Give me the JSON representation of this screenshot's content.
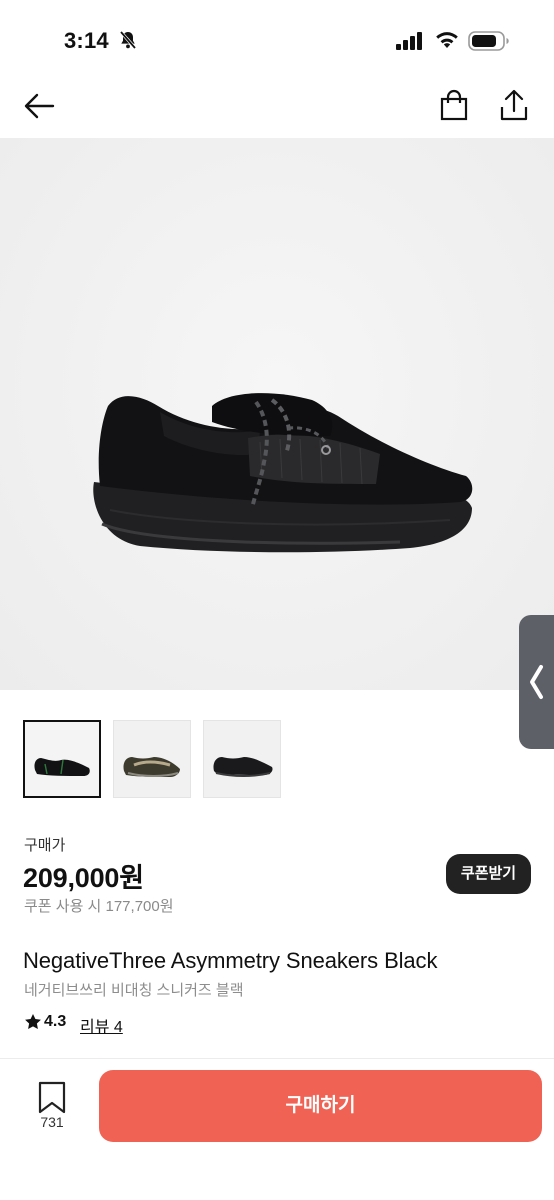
{
  "status_bar": {
    "time": "3:14"
  },
  "header": {
    "back_icon": "arrow-left-icon",
    "bag_icon": "shopping-bag-icon",
    "share_icon": "share-upload-icon"
  },
  "gallery": {
    "thumbnails": [
      {
        "alt": "black sneaker side view",
        "selected": true
      },
      {
        "alt": "olive sneaker top view",
        "selected": false
      },
      {
        "alt": "black sneaker side view dark",
        "selected": false
      }
    ]
  },
  "price": {
    "label": "구매가",
    "value": "209,000원",
    "coupon_text": "쿠폰 사용 시 177,700원",
    "coupon_button": "쿠폰받기"
  },
  "product": {
    "name": "NegativeThree Asymmetry Sneakers Black",
    "name_ko": "네거티브쓰리 비대칭 스니커즈 블랙",
    "rating": "4.3",
    "review_link": "리뷰 4"
  },
  "bottom_bar": {
    "bookmark_count": "731",
    "buy_button": "구매하기"
  },
  "colors": {
    "buy_button": "#f06354",
    "coupon_button": "#222222"
  }
}
